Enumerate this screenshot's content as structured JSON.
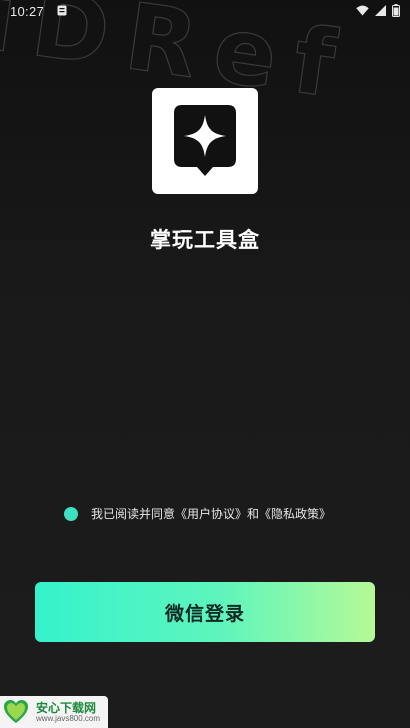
{
  "status_bar": {
    "time": "10:27"
  },
  "watermark": {
    "text": "iDRef"
  },
  "app": {
    "name": "掌玩工具盒",
    "icon": "sparkle-pin-icon"
  },
  "agreement": {
    "checked": true,
    "prefix": "我已阅读并同意",
    "user_agreement": "《用户协议》",
    "conjunction": "和",
    "privacy_policy": "《隐私政策》"
  },
  "login": {
    "wechat_label": "微信登录"
  },
  "source_badge": {
    "name": "安心下载网",
    "url": "www.javs800.com",
    "logo_text": "安心\n下载"
  },
  "colors": {
    "background": "#171717",
    "accent_start": "#35f2cc",
    "accent_end": "#b5f996",
    "radio": "#3de0c0"
  }
}
